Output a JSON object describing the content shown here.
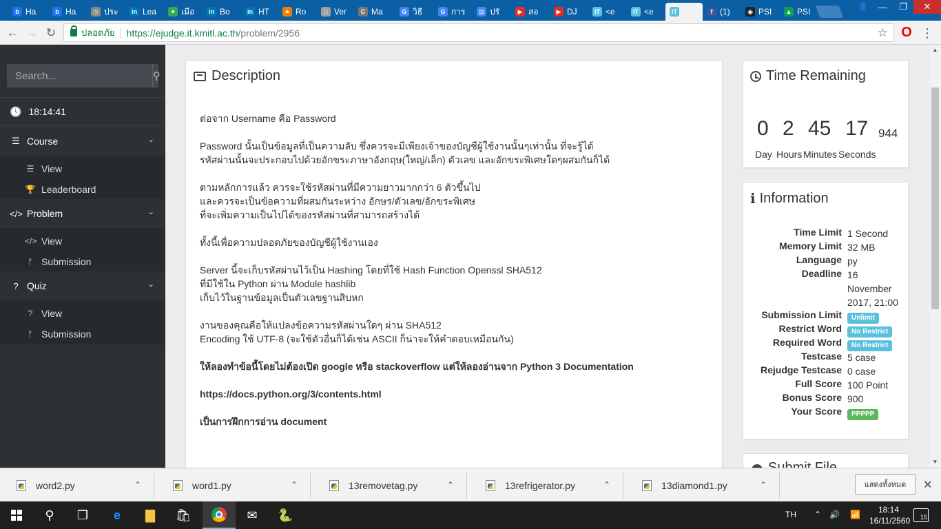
{
  "browser": {
    "tabs": [
      {
        "label": "Ha",
        "color": "#1a73e8",
        "letter": "b"
      },
      {
        "label": "Ha",
        "color": "#1a73e8",
        "letter": "b"
      },
      {
        "label": "ประ",
        "color": "#888888",
        "letter": "◷"
      },
      {
        "label": "Lea",
        "color": "#0077b5",
        "letter": "in"
      },
      {
        "label": "เมือ",
        "color": "#3aa757",
        "letter": "✦"
      },
      {
        "label": "Bo",
        "color": "#0077b5",
        "letter": "in"
      },
      {
        "label": "HT",
        "color": "#0077b5",
        "letter": "in"
      },
      {
        "label": "Ro",
        "color": "#f57c00",
        "letter": "★"
      },
      {
        "label": "Ver",
        "color": "#9e9e9e",
        "letter": "□"
      },
      {
        "label": "Ma",
        "color": "#777777",
        "letter": "C"
      },
      {
        "label": "วิธี",
        "color": "#4285f4",
        "letter": "G"
      },
      {
        "label": "การ",
        "color": "#4285f4",
        "letter": "G"
      },
      {
        "label": "ปรั",
        "color": "#4285f4",
        "letter": "▤"
      },
      {
        "label": "สอ",
        "color": "#e52d27",
        "letter": "▶"
      },
      {
        "label": "DJ",
        "color": "#e52d27",
        "letter": "▶"
      },
      {
        "label": "<e",
        "color": "#5bc0de",
        "letter": "iT"
      },
      {
        "label": "<e",
        "color": "#5bc0de",
        "letter": "iT"
      },
      {
        "label": "",
        "color": "#5bc0de",
        "letter": "iT"
      },
      {
        "label": "(1)",
        "color": "#3b5998",
        "letter": "f"
      },
      {
        "label": "PSI",
        "color": "#222222",
        "letter": "◉"
      },
      {
        "label": "PSI",
        "color": "#0f9d58",
        "letter": "▲"
      }
    ],
    "active_tab_index": 17,
    "secure_label": "ปลอดภัย",
    "url_host": "https://ejudge.it.kmitl.ac.th",
    "url_path": "/problem/2956"
  },
  "sidebar": {
    "search_placeholder": "Search...",
    "clock": "18:14:41",
    "sections": [
      {
        "label": "Course",
        "icon": "list-icon",
        "glyph": "☰",
        "items": [
          {
            "label": "View",
            "icon": "list-icon",
            "glyph": "☰"
          },
          {
            "label": "Leaderboard",
            "icon": "trophy-icon",
            "glyph": "🏆"
          }
        ]
      },
      {
        "label": "Problem",
        "icon": "code-icon",
        "glyph": "</>",
        "items": [
          {
            "label": "View",
            "icon": "code-icon",
            "glyph": "</>"
          },
          {
            "label": "Submission",
            "icon": "code-fork-icon",
            "glyph": "ᚠ"
          }
        ]
      },
      {
        "label": "Quiz",
        "icon": "question-icon",
        "glyph": "?",
        "items": [
          {
            "label": "View",
            "icon": "question-icon",
            "glyph": "?"
          },
          {
            "label": "Submission",
            "icon": "code-fork-icon",
            "glyph": "ᚠ"
          }
        ]
      }
    ]
  },
  "description": {
    "title": "Description",
    "lines": [
      "ต่อจาก Username คือ Password",
      "",
      "Password นั้นเป็นข้อมูลที่เป็นความลับ ซึ่งควรจะมีเพียงเจ้าของบัญชีผู้ใช้งานนั้นๆเท่านั้น ที่จะรู้ได้",
      "รหัสผ่านนั้นจะประกอบไปด้วยอักขระภาษาอังกฤษ(ใหญ่/เล็ก) ตัวเลข และอักขระพิเศษใดๆผสมกันก็ได้",
      "",
      "ตามหลักการแล้ว ควรจะใช้รหัสผ่านที่มีความยาวมากกว่า 6 ตัวขึ้นไป",
      "และควรจะเป็นข้อความที่ผสมกันระหว่าง อักษร/ตัวเลข/อักขระพิเศษ",
      "ที่จะเพิ่มความเป็นไปได้ของรหัสผ่านที่สามารถสร้างได้",
      "",
      "ทั้งนี้เพื่อความปลอดภัยของบัญชีผู้ใช้งานเอง",
      "",
      "Server นี้จะเก็บรหัสผ่านไว้เป็น Hashing โดยที่ใช้ Hash Function Openssl SHA512",
      "ที่มีใช้ใน Python ผ่าน Module hashlib",
      "เก็บไว้ในฐานข้อมูลเป็นตัวเลขฐานสิบหก",
      "",
      "งานของคุณคือให้แปลงข้อความรหัสผ่านใดๆ ผ่าน SHA512",
      "Encoding ใช้ UTF-8 (จะใช้ตัวอื่นก็ได้เช่น ASCII ก็น่าจะให้คำตอบเหมือนกัน)",
      ""
    ],
    "bold_lines": [
      "ให้ลองทำข้อนี้โดยไม่ต้องเปิด google หรือ stackoverflow แต่ให้ลองอ่านจาก Python 3 Documentation",
      "",
      "https://docs.python.org/3/contents.html",
      "",
      "เป็นการฝึกการอ่าน document"
    ]
  },
  "timer": {
    "title": "Time Remaining",
    "day": "0",
    "hours": "2",
    "minutes": "45",
    "seconds": "17",
    "ms": "944",
    "day_label": "Day",
    "hours_label": "Hours",
    "minutes_label": "Minutes",
    "seconds_label": "Seconds"
  },
  "info": {
    "title": "Information",
    "rows": [
      {
        "key": "Time Limit",
        "value": "1 Second"
      },
      {
        "key": "Memory Limit",
        "value": "32 MB"
      },
      {
        "key": "Language",
        "value": "py"
      },
      {
        "key": "Deadline",
        "value": "16 November 2017, 21:00"
      },
      {
        "key": "Submission Limit",
        "value": "Unlimit",
        "badge": "info"
      },
      {
        "key": "Restrict Word",
        "value": "No Restrict",
        "badge": "info"
      },
      {
        "key": "Required Word",
        "value": "No Restrict",
        "badge": "info"
      },
      {
        "key": "Testcase",
        "value": "5 case"
      },
      {
        "key": "Rejudge Testcase",
        "value": "0 case"
      },
      {
        "key": "Full Score",
        "value": "100 Point"
      },
      {
        "key": "Bonus Score",
        "value": "900"
      },
      {
        "key": "Your Score",
        "value": "PPPPP",
        "badge": "ok"
      }
    ]
  },
  "submit_panel": {
    "title": "Submit File"
  },
  "downloads": {
    "files": [
      "word2.py",
      "word1.py",
      "13removetag.py",
      "13refrigerator.py",
      "13diamond1.py"
    ],
    "show_all_label": "แสดงทั้งหมด"
  },
  "taskbar": {
    "lang": "TH",
    "time": "18:14",
    "date": "16/11/2560",
    "notifications": "15"
  }
}
